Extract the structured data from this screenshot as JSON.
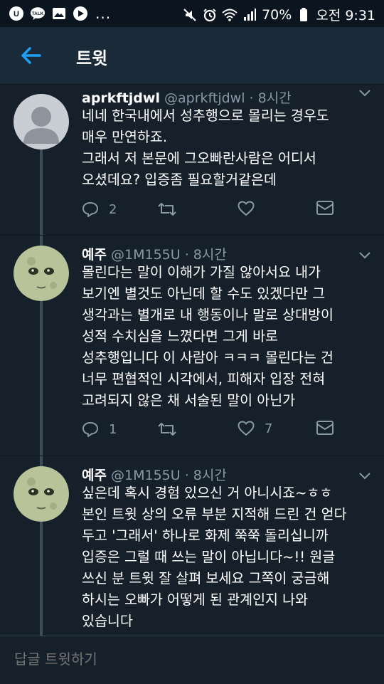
{
  "status_bar": {
    "battery": "70%",
    "time": "오전 9:31",
    "more": "...",
    "icons_left": [
      "app-u-icon",
      "kakaotalk-icon",
      "gallery-icon",
      "youtube-icon"
    ],
    "icons_right": [
      "mute-icon",
      "alarm-icon",
      "wifi-icon",
      "signal-icon",
      "battery-icon"
    ]
  },
  "header": {
    "title": "트윗"
  },
  "tweets": [
    {
      "name": "aprkftjdwl",
      "handle": "@aprkftjdwl",
      "time": "· 8시간",
      "text": "네네 한국내에서 성추행으로 몰리는 경우도\n매우 만연하죠.\n그래서 저 본문에 그오빠란사람은 어디서\n오셨데요? 입증좀 필요할거같은데",
      "replies": "2",
      "retweets": "",
      "likes": "",
      "avatar": "default-avatar"
    },
    {
      "name": "예주",
      "handle": "@1M155U",
      "time": "· 8시간",
      "text": "몰린다는 말이 이해가 가질 않아서요 내가\n보기엔 별것도 아닌데 할 수도 있겠다만 그\n생각과는 별개로 내 행동이나 말로 상대방이\n성적 수치심을 느꼈다면 그게 바로\n성추행입니다 이 사람아 ㅋㅋㅋ 몰린다는 건\n너무 편협적인 시각에서, 피해자 입장 전혀\n고려되지 않은 채 서술된 말이 아닌가",
      "replies": "1",
      "retweets": "",
      "likes": "7",
      "avatar": "moon-face-avatar"
    },
    {
      "name": "예주",
      "handle": "@1M155U",
      "time": "· 8시간",
      "text": "싶은데 혹시 경험 있으신 거 아니시죠~ㅎㅎ\n본인 트윗 상의 오류 부분 지적해 드린 건 얻다\n두고 '그래서' 하나로 화제 쭉쭉 돌리십니까\n입증은 그럴 때 쓰는 말이 아닙니다~!! 원글\n쓰신 분 트윗 잘 살펴 보세요 그쪽이 궁금해\n하시는 오빠가 어떻게 된 관계인지 나와\n있습니다",
      "avatar": "moon-face-avatar"
    }
  ],
  "reply_bar": {
    "placeholder": "답글 트윗하기"
  },
  "colors": {
    "background": "#15202b",
    "appbar": "#1b2a39",
    "accent": "#1da1f2",
    "secondary_text": "#8899a6"
  }
}
